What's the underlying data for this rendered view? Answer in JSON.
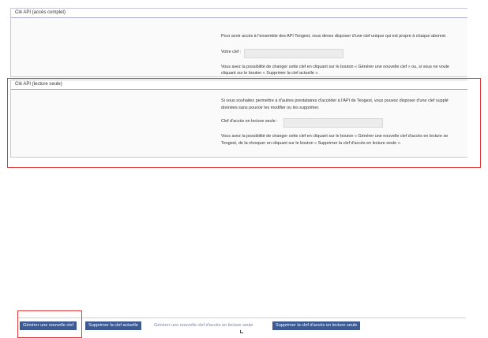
{
  "full_api": {
    "title": "Clé API (accès complet)",
    "intro": "Pour avoir accès à l'ensemble des API Teogest, vous devez disposer d'une clef unique qui est propre à chaque abonné.",
    "key_label": "Votre clef :",
    "key_value": "",
    "help_line1": "Vous avez la possibilité de changer cette clef en cliquant sur le bouton « Générer une nouvelle clef » ou, si vous ne voule",
    "help_line2": "cliquant sur le bouton « Supprimer la clef actuelle »."
  },
  "readonly_api": {
    "title": "Clé API (lecture seule)",
    "intro_line1": "Si vous souhaitez permettre à d'autres prestataires d'accéder à l'API de Teogest, vous pouvez disposer d'une clef supplé",
    "intro_line2": "données sans pouvoir les modifier ou les supprimer.",
    "key_label": "Clef d'accès en lecture seule :",
    "key_value": "",
    "help_line1": "Vous avez la possibilité de changer cette clef en cliquant sur le bouton « Générer une nouvelle clef d'accès en lecture se",
    "help_line2": "Teogest, de la révoquer en cliquant sur le bouton « Supprimer la clef d'accès en lecture seule »."
  },
  "buttons": {
    "generate": "Générer une nouvelle clef",
    "delete": "Supprimer la clef actuelle",
    "generate_readonly": "Générer une nouvelle clef d'accès en lecture seule",
    "delete_readonly": "Supprimer la clef d'accès en lecture seule"
  },
  "colors": {
    "button_bg": "#3d5a93",
    "highlight": "#e03a3a",
    "panel_border": "#a9a9d6"
  }
}
